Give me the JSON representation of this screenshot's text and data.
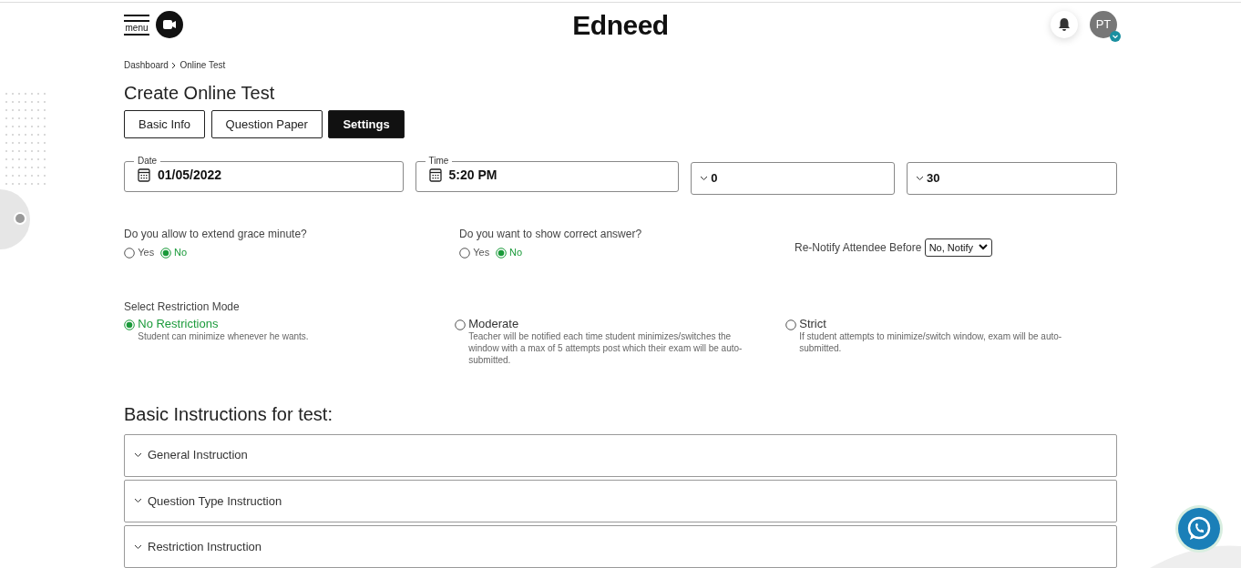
{
  "header": {
    "menu_label": "menu",
    "logo": "Edneed",
    "avatar_initials": "PT"
  },
  "breadcrumb": [
    "Dashboard",
    "Online Test"
  ],
  "title": "Create Online Test",
  "tabs": [
    {
      "label": "Basic Info",
      "selected": false
    },
    {
      "label": "Question Paper",
      "selected": false
    },
    {
      "label": "Settings",
      "selected": true
    }
  ],
  "fields": [
    {
      "kind": "date",
      "label": "Date",
      "value": "01/05/2022"
    },
    {
      "kind": "time",
      "label": "Time",
      "value": "5:20 PM"
    },
    {
      "kind": "select",
      "value": "0"
    },
    {
      "kind": "select",
      "value": "30"
    }
  ],
  "questions": [
    {
      "question": "Do you allow to extend grace minute?",
      "options": [
        {
          "label": "Yes",
          "selected": false
        },
        {
          "label": "No",
          "selected": true
        }
      ]
    },
    {
      "question": "Do you want to show correct answer?",
      "options": [
        {
          "label": "Yes",
          "selected": false
        },
        {
          "label": "No",
          "selected": true
        }
      ]
    }
  ],
  "renotify": {
    "label": "Re-Notify Attendee Before",
    "value": "No, Notify"
  },
  "restriction": {
    "label": "Select Restriction Mode",
    "options": [
      {
        "title": "No Restrictions",
        "description": "Student can minimize whenever he wants.",
        "selected": true
      },
      {
        "title": "Moderate",
        "description": "Teacher will be notified each time student minimizes/switches the window with a max of 5 attempts post which their exam will be auto-submitted.",
        "selected": false
      },
      {
        "title": "Strict",
        "description": "If student attempts to minimize/switch window, exam will be auto-submitted.",
        "selected": false
      }
    ]
  },
  "instructions": {
    "heading": "Basic Instructions for test:",
    "sections": [
      {
        "title": "General Instruction",
        "expanded": false
      },
      {
        "title": "Question Type Instruction",
        "expanded": false
      },
      {
        "title": "Restriction Instruction",
        "expanded": false
      }
    ]
  }
}
